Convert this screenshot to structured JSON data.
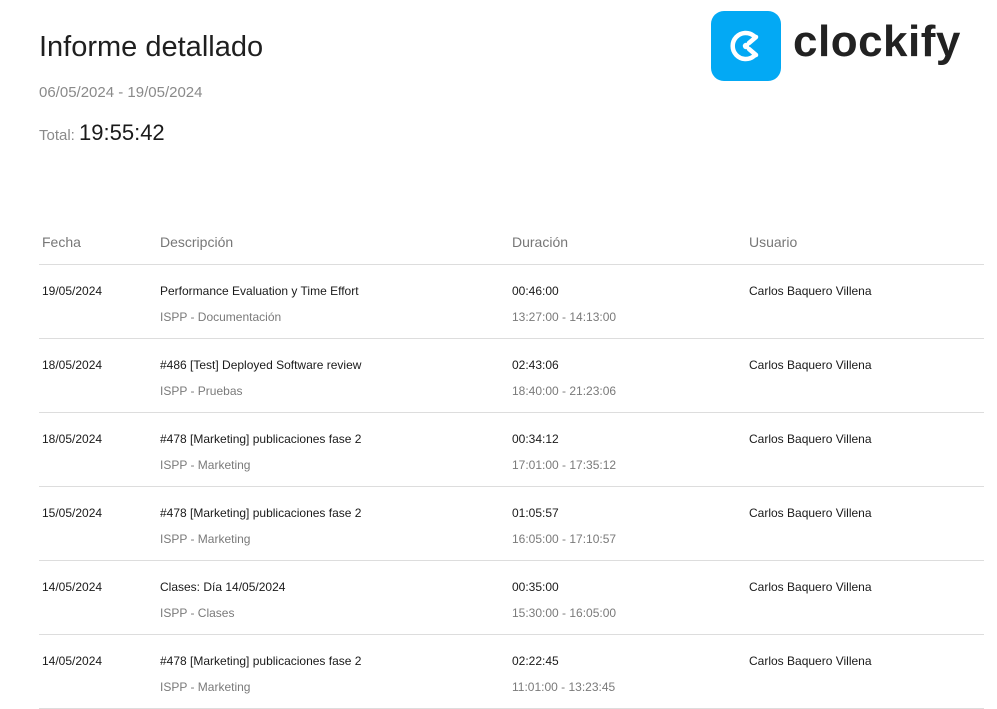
{
  "report": {
    "title": "Informe detallado",
    "date_range": "06/05/2024 - 19/05/2024",
    "total_label": "Total:",
    "total_value": "19:55:42"
  },
  "logo": {
    "text": "clockify",
    "icon": "clockify-logo-icon",
    "color": "#03a9f4"
  },
  "table": {
    "headers": {
      "date": "Fecha",
      "description": "Descripción",
      "duration": "Duración",
      "user": "Usuario"
    },
    "rows": [
      {
        "date": "19/05/2024",
        "description": "Performance Evaluation y Time Effort",
        "project": "ISPP - Documentación",
        "duration": "00:46:00",
        "time_range": "13:27:00 - 14:13:00",
        "user": "Carlos Baquero Villena"
      },
      {
        "date": "18/05/2024",
        "description": "#486 [Test] Deployed Software review",
        "project": "ISPP - Pruebas",
        "duration": "02:43:06",
        "time_range": "18:40:00 - 21:23:06",
        "user": "Carlos Baquero Villena"
      },
      {
        "date": "18/05/2024",
        "description": "#478 [Marketing] publicaciones fase 2",
        "project": "ISPP - Marketing",
        "duration": "00:34:12",
        "time_range": "17:01:00 - 17:35:12",
        "user": "Carlos Baquero Villena"
      },
      {
        "date": "15/05/2024",
        "description": "#478 [Marketing] publicaciones fase 2",
        "project": "ISPP - Marketing",
        "duration": "01:05:57",
        "time_range": "16:05:00 - 17:10:57",
        "user": "Carlos Baquero Villena"
      },
      {
        "date": "14/05/2024",
        "description": "Clases: Día 14/05/2024",
        "project": "ISPP - Clases",
        "duration": "00:35:00",
        "time_range": "15:30:00 - 16:05:00",
        "user": "Carlos Baquero Villena"
      },
      {
        "date": "14/05/2024",
        "description": "#478 [Marketing] publicaciones fase 2",
        "project": "ISPP - Marketing",
        "duration": "02:22:45",
        "time_range": "11:01:00 - 13:23:45",
        "user": "Carlos Baquero Villena"
      }
    ]
  }
}
